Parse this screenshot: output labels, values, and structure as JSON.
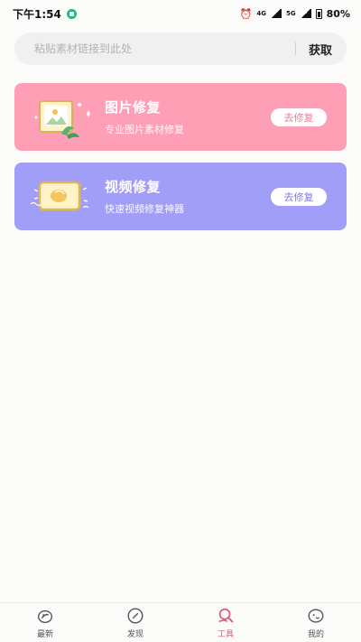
{
  "status": {
    "time": "下午1:54",
    "net1": "4G",
    "net2": "5G",
    "battery": "80%"
  },
  "search": {
    "placeholder": "粘贴素材链接到此处",
    "action": "获取"
  },
  "cards": [
    {
      "title": "图片修复",
      "subtitle": "专业图片素材修复",
      "button": "去修复",
      "color": "#fe9fb6"
    },
    {
      "title": "视频修复",
      "subtitle": "快速视频修复神器",
      "button": "去修复",
      "color": "#a19ef7"
    }
  ],
  "nav": [
    {
      "label": "最新",
      "icon": "home-leaf-icon"
    },
    {
      "label": "发现",
      "icon": "compass-icon"
    },
    {
      "label": "工具",
      "icon": "tool-search-icon",
      "active": true
    },
    {
      "label": "我的",
      "icon": "profile-face-icon"
    }
  ],
  "colors": {
    "accent": "#e0557a",
    "pink_card": "#fe9fb6",
    "purple_card": "#a19ef7"
  }
}
